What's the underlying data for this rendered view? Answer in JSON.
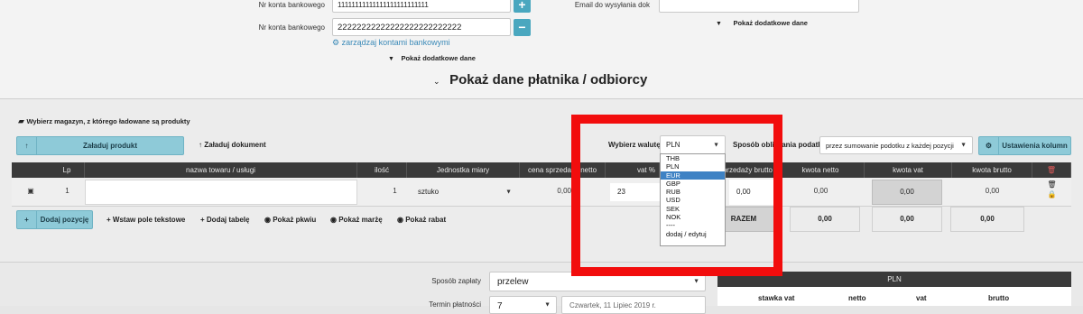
{
  "bank": {
    "label1": "Nr konta bankowego",
    "value1": "11111111111111111111111111",
    "label2": "Nr konta bankowego",
    "value2": "22222222222222222222222222",
    "plus": "+",
    "minus": "−",
    "manage_link": "zarządzaj kontami bankowymi",
    "more_data_left": "Pokaż dodatkowe dane",
    "email_label": "Email do wysyłania dok",
    "more_data_right": "Pokaż dodatkowe dane"
  },
  "payer_section": {
    "title": "Pokaż dane płatnika / odbiorcy"
  },
  "warehouse": {
    "label": "Wybierz magazyn, z którego ładowane są produkty"
  },
  "toolbar": {
    "load_product": "Załaduj produkt",
    "load_document": "Załaduj dokument",
    "currency_label": "Wybierz walutę",
    "currency_value": "PLN",
    "tax_method_label": "Sposób obliczania podatku",
    "tax_method_value": "przez sumowanie podotku z każdej pozycji",
    "column_settings": "Ustawienia kolumn"
  },
  "table": {
    "headers": [
      "Lp",
      "nazwa towaru / usługi",
      "ilość",
      "Jednostka miary",
      "cena sprzedaży netto",
      "vat %",
      "cena sprzedaży brutto",
      "kwota netto",
      "kwota vat",
      "kwota brutto"
    ],
    "row": {
      "lp": "1",
      "name": "",
      "qty": "1",
      "unit": "sztuko",
      "net_price": "0,00",
      "vat": "23",
      "gross_price": "0,00",
      "net_amount": "0,00",
      "vat_amount": "0,00",
      "gross_amount": "0,00"
    },
    "total": {
      "label": "RAZEM",
      "net": "0,00",
      "vat": "0,00",
      "gross": "0,00"
    }
  },
  "actions": {
    "add_position": "Dodaj pozycję",
    "insert_text": "Wstaw pole tekstowe",
    "add_table": "Dodaj tabelę",
    "show_pkwiu": "Pokaż pkwiu",
    "show_margin": "Pokaż marżę",
    "show_discount": "Pokaż rabat"
  },
  "currency_dropdown": {
    "options": [
      "THB",
      "PLN",
      "EUR",
      "GBP",
      "RUB",
      "USD",
      "SEK",
      "NOK",
      "----",
      "dodaj / edytuj"
    ],
    "highlighted": "EUR"
  },
  "payment": {
    "method_label": "Sposób zapłaty",
    "method_value": "przelew",
    "term_label": "Termin płatności",
    "term_value": "7",
    "date_value": "Czwartek, 11 Lipiec 2019 r."
  },
  "summary": {
    "currency": "PLN",
    "headers": [
      "stawka vat",
      "netto",
      "vat",
      "brutto"
    ]
  },
  "colors": {
    "accent": "#4aa7bf",
    "highlight_frame": "#f20d0d",
    "selected_option": "#3e82c4"
  }
}
